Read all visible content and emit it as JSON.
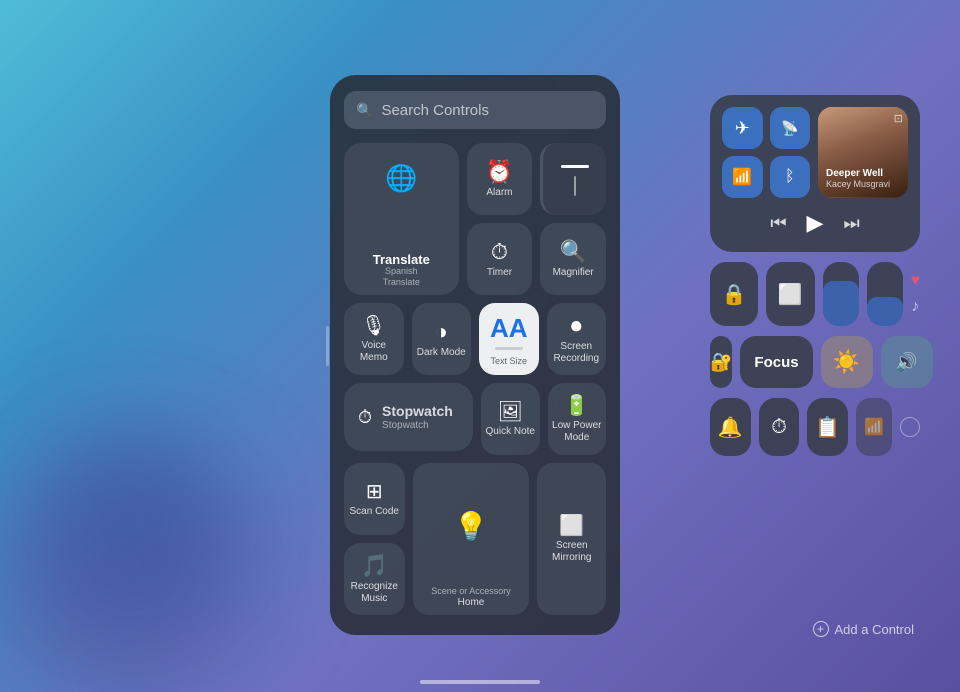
{
  "search": {
    "placeholder": "Search Controls"
  },
  "controls_panel": {
    "title": "Search Controls",
    "items": [
      {
        "id": "translate",
        "label": "Translate",
        "sublabel": "Spanish",
        "icon": "🌐",
        "size": "large"
      },
      {
        "id": "alarm",
        "label": "Alarm",
        "icon": "⏰"
      },
      {
        "id": "timer",
        "label": "Timer",
        "icon": "⏱"
      },
      {
        "id": "magnifier",
        "label": "Magnifier",
        "icon": "🔍"
      },
      {
        "id": "voice-memo",
        "label": "Voice Memo",
        "icon": "🎙"
      },
      {
        "id": "dark-mode",
        "label": "Dark Mode",
        "icon": "◑"
      },
      {
        "id": "text-size",
        "label": "Text Size",
        "icon": "AA"
      },
      {
        "id": "screen-recording",
        "label": "Screen Recording",
        "icon": "⏺"
      },
      {
        "id": "stopwatch",
        "label": "Stopwatch",
        "sublabel": "Stopwatch",
        "icon": "⏱",
        "size": "wide"
      },
      {
        "id": "quick-note",
        "label": "Quick Note",
        "icon": "📝"
      },
      {
        "id": "low-power",
        "label": "Low Power Mode",
        "icon": "🔋"
      },
      {
        "id": "scan-code",
        "label": "Scan Code",
        "icon": "⬛"
      },
      {
        "id": "home",
        "label": "Home",
        "sublabel": "Scene or Accessory",
        "icon": "💡",
        "size": "home"
      },
      {
        "id": "screen-mirroring",
        "label": "Screen Mirroring",
        "icon": "⬜"
      },
      {
        "id": "recognize-music",
        "label": "Recognize Music",
        "icon": "🎵"
      }
    ]
  },
  "now_playing": {
    "song_title": "Deeper Well",
    "artist": "Kacey Musgravi",
    "controls": {
      "rewind": "⏮",
      "play": "▶",
      "forward": "⏭"
    }
  },
  "connectivity": {
    "airplane": {
      "icon": "✈",
      "active": true
    },
    "airdrop": {
      "icon": "📡",
      "active": true
    },
    "wifi": {
      "icon": "📶",
      "active": true
    },
    "bluetooth": {
      "icon": "🅱",
      "active": true
    }
  },
  "focus": {
    "label": "Focus"
  },
  "right_controls": {
    "lock_rotation": {
      "icon": "🔒"
    },
    "screen_mirror": {
      "icon": "⬜"
    },
    "bell": {
      "icon": "🔔"
    },
    "timer_right": {
      "icon": "⏱"
    },
    "notes": {
      "icon": "📋"
    },
    "signal": {
      "icon": "📶"
    }
  },
  "add_control": {
    "label": "Add a Control"
  }
}
